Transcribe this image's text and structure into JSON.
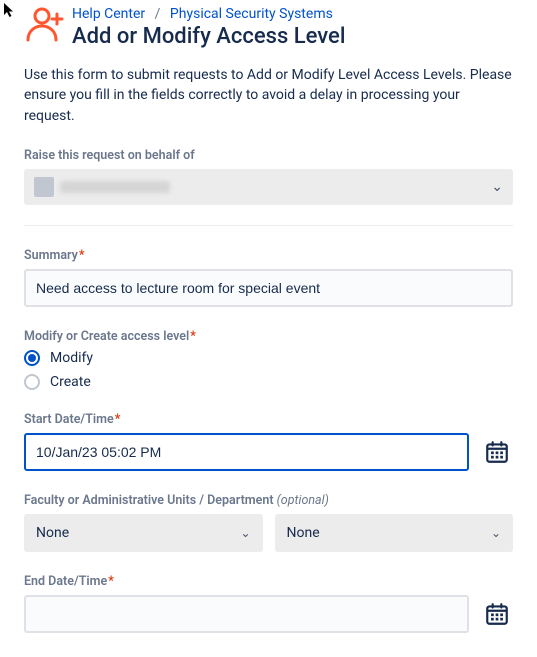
{
  "breadcrumbs": {
    "help_center": "Help Center",
    "category": "Physical Security Systems"
  },
  "title": "Add or Modify Access Level",
  "intro": "Use this form to submit requests to Add or Modify Level Access Levels. Please ensure you fill in the fields correctly to avoid a delay in processing your request.",
  "labels": {
    "on_behalf": "Raise this request on behalf of",
    "summary": "Summary",
    "modify_create": "Modify or Create access level",
    "start": "Start Date/Time",
    "faculty": "Faculty or Administrative Units / Department",
    "optional": "(optional)",
    "end": "End Date/Time",
    "star": "*"
  },
  "summary_value": "Need access to lecture room for special event",
  "radios": {
    "modify": "Modify",
    "create": "Create",
    "selected": "modify"
  },
  "start_value": "10/Jan/23 05:02 PM",
  "faculty_select": "None",
  "department_select": "None",
  "end_value": "",
  "icons": {
    "chevron": "⌄"
  }
}
